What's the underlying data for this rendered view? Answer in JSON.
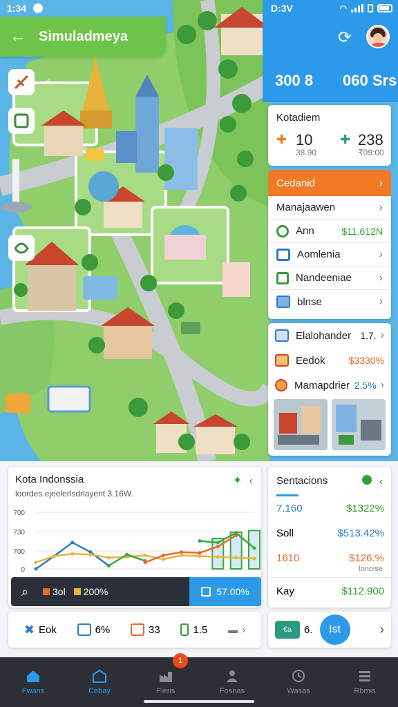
{
  "status": {
    "time_left": "1:34",
    "time_right": "D:3V"
  },
  "header": {
    "back_icon": "arrow-left-icon",
    "title": "Simuladmeya"
  },
  "hud": {
    "stat1": "300 8",
    "stat2": "060 Srs"
  },
  "kp_panel": {
    "title": "Kotadiem",
    "stat1": "10",
    "stat1_sub": "38.90",
    "stat2": "238",
    "stat2_sub": "₹09:00"
  },
  "orange_button": {
    "label": "Cedanid"
  },
  "menu": {
    "header": "Manajaawen",
    "items": [
      {
        "label": "Ann",
        "value": "$11.612N",
        "icon": "recycle-icon",
        "color": "#3a9a3a"
      },
      {
        "label": "Aomlenia",
        "icon": "folder-icon",
        "color": "#2d7ac7"
      },
      {
        "label": "Nandeeniae",
        "icon": "square-icon",
        "color": "#3a9a3a"
      },
      {
        "label": "blnse",
        "icon": "box-icon",
        "color": "#2d7ac7"
      }
    ]
  },
  "resources": [
    {
      "label": "Elalohander",
      "value": "1.7.",
      "icon": "rocket-icon"
    },
    {
      "label": "Eedok",
      "value": "$3330%",
      "icon": "house-icon"
    },
    {
      "label": "Mamapdrier",
      "value": "2.5%",
      "icon": "badge-icon"
    }
  ],
  "chart_panel": {
    "title": "Kota Indonssia",
    "subtitle": "loordes.ejeelerlsdrlayent 3.16W.",
    "footer_a": "3ol",
    "footer_b": "200%",
    "footer_value": "57.00%"
  },
  "chart_data": {
    "type": "line",
    "x": [
      0,
      1,
      2,
      3,
      4,
      5,
      6,
      7,
      8,
      9,
      10,
      11,
      12
    ],
    "yticks": [
      "0",
      "700",
      "730",
      "700"
    ],
    "ylim": [
      0,
      760
    ],
    "series": [
      {
        "color": "#2d7ac7",
        "values": [
          0,
          160,
          330,
          210,
          40,
          null,
          null,
          null,
          null,
          null,
          null,
          null,
          null
        ]
      },
      {
        "color": "#e5b53c",
        "values": [
          80,
          160,
          190,
          180,
          140,
          150,
          170,
          120,
          170,
          160,
          150,
          140,
          130
        ]
      },
      {
        "color": "#3aa841",
        "values": [
          null,
          null,
          null,
          null,
          40,
          180,
          100,
          null,
          null,
          null,
          null,
          null,
          null
        ]
      },
      {
        "color": "#e86a2a",
        "values": [
          null,
          null,
          null,
          null,
          null,
          null,
          80,
          170,
          210,
          200,
          280,
          420,
          null
        ]
      },
      {
        "color": "#3aa841",
        "values": [
          null,
          null,
          null,
          null,
          null,
          null,
          null,
          null,
          null,
          350,
          330,
          450,
          260
        ]
      }
    ],
    "bars": [
      {
        "x": 10,
        "value": 380
      },
      {
        "x": 11,
        "value": 460
      },
      {
        "x": 12,
        "value": 480
      }
    ]
  },
  "sentiment": {
    "title": "Sentacions",
    "rows": [
      {
        "label": "7.160",
        "value": "$1322%",
        "label_color": "#2d7ac7",
        "value_color": "#3a9a3a"
      },
      {
        "label": "Soll",
        "value": "$513.42%",
        "label_color": "#222222",
        "value_color": "#2d7ac7"
      },
      {
        "label": "1610",
        "value": "$126.%",
        "sub": "lonoise",
        "label_color": "#e86a2a",
        "value_color": "#e86a2a"
      },
      {
        "label": "Kay",
        "value": "$112.900",
        "label_color": "#222222",
        "value_color": "#3a9a3a"
      }
    ]
  },
  "bottom_icons": [
    {
      "label": "Eok",
      "icon": "crane-icon",
      "color": "#2d7ac7"
    },
    {
      "label": "6%",
      "icon": "grid-icon",
      "color": "#2d7ac7"
    },
    {
      "label": "33",
      "icon": "crate-icon",
      "color": "#e86a2a"
    },
    {
      "label": "1.5",
      "icon": "phone-icon",
      "color": "#3a9a3a"
    }
  ],
  "bottom_action": {
    "badge": "€a",
    "value": "6.",
    "circle_label": "Ist"
  },
  "nav": {
    "badge": "1",
    "items": [
      {
        "label": "Fwans",
        "icon": "home-icon"
      },
      {
        "label": "Cebay",
        "icon": "store-icon"
      },
      {
        "label": "Fieris",
        "icon": "factory-icon"
      },
      {
        "label": "Fosnas",
        "icon": "people-icon"
      },
      {
        "label": "Wasas",
        "icon": "clock-icon"
      },
      {
        "label": "Rbmis",
        "icon": "list-icon"
      }
    ]
  },
  "colors": {
    "accent_blue": "#2d9ae9",
    "accent_green": "#6ec34a",
    "accent_orange": "#f27a25",
    "nav_bg": "#2c2f36"
  }
}
